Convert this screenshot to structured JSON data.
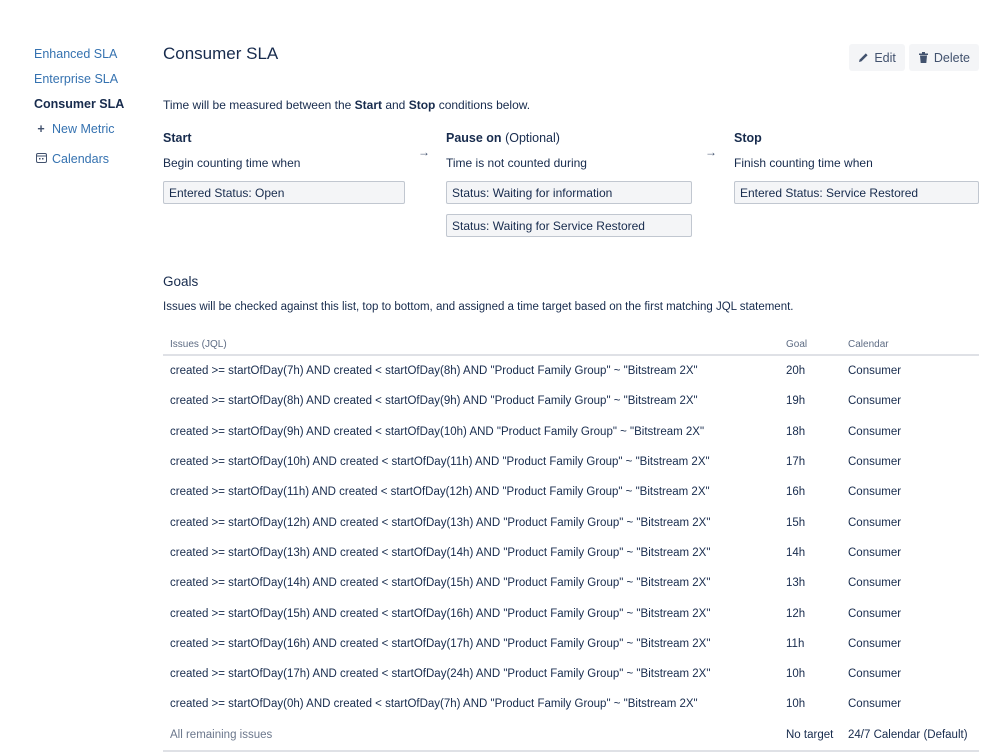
{
  "sidebar": {
    "items": [
      {
        "label": "Enhanced SLA"
      },
      {
        "label": "Enterprise SLA"
      },
      {
        "label": "Consumer SLA"
      },
      {
        "label": "New Metric",
        "icon": "plus-icon"
      },
      {
        "label": "Calendars",
        "icon": "calendar-icon"
      }
    ]
  },
  "header": {
    "title": "Consumer SLA",
    "edit_label": "Edit",
    "delete_label": "Delete"
  },
  "intro": {
    "prefix": "Time will be measured between the ",
    "start_word": "Start",
    "middle": " and ",
    "stop_word": "Stop",
    "suffix": " conditions below."
  },
  "conditions": {
    "start": {
      "heading": "Start",
      "description": "Begin counting time when",
      "items": [
        "Entered Status: Open"
      ]
    },
    "pause": {
      "heading": "Pause on",
      "optional": "(Optional)",
      "description": "Time is not counted during",
      "items": [
        "Status: Waiting for information",
        "Status: Waiting for Service Restored"
      ]
    },
    "stop": {
      "heading": "Stop",
      "description": "Finish counting time when",
      "items": [
        "Entered Status: Service Restored"
      ]
    },
    "arrow": "→"
  },
  "goals": {
    "title": "Goals",
    "description": "Issues will be checked against this list, top to bottom, and assigned a time target based on the first matching JQL statement.",
    "columns": {
      "jql": "Issues (JQL)",
      "goal": "Goal",
      "calendar": "Calendar"
    },
    "rows": [
      {
        "jql": "created >= startOfDay(7h) AND created < startOfDay(8h) AND \"Product Family Group\" ~ \"Bitstream 2X\"",
        "goal": "20h",
        "calendar": "Consumer"
      },
      {
        "jql": "created >= startOfDay(8h) AND created < startOfDay(9h) AND \"Product Family Group\" ~ \"Bitstream 2X\"",
        "goal": "19h",
        "calendar": "Consumer"
      },
      {
        "jql": "created >= startOfDay(9h) AND created < startOfDay(10h) AND \"Product Family Group\" ~ \"Bitstream 2X\"",
        "goal": "18h",
        "calendar": "Consumer"
      },
      {
        "jql": "created >= startOfDay(10h) AND created < startOfDay(11h) AND \"Product Family Group\" ~ \"Bitstream 2X\"",
        "goal": "17h",
        "calendar": "Consumer"
      },
      {
        "jql": "created >= startOfDay(11h) AND created < startOfDay(12h) AND \"Product Family Group\" ~ \"Bitstream 2X\"",
        "goal": "16h",
        "calendar": "Consumer"
      },
      {
        "jql": "created >= startOfDay(12h) AND created < startOfDay(13h) AND \"Product Family Group\" ~ \"Bitstream 2X\"",
        "goal": "15h",
        "calendar": "Consumer"
      },
      {
        "jql": "created >= startOfDay(13h) AND created < startOfDay(14h) AND \"Product Family Group\" ~ \"Bitstream 2X\"",
        "goal": "14h",
        "calendar": "Consumer"
      },
      {
        "jql": "created >= startOfDay(14h) AND created < startOfDay(15h) AND \"Product Family Group\" ~ \"Bitstream 2X\"",
        "goal": "13h",
        "calendar": "Consumer"
      },
      {
        "jql": "created >= startOfDay(15h) AND created < startOfDay(16h) AND \"Product Family Group\" ~ \"Bitstream 2X\"",
        "goal": "12h",
        "calendar": "Consumer"
      },
      {
        "jql": "created >= startOfDay(16h) AND created < startOfDay(17h) AND \"Product Family Group\" ~ \"Bitstream 2X\"",
        "goal": "11h",
        "calendar": "Consumer"
      },
      {
        "jql": "created >= startOfDay(17h) AND created < startOfDay(24h) AND \"Product Family Group\" ~ \"Bitstream 2X\"",
        "goal": "10h",
        "calendar": "Consumer"
      },
      {
        "jql": "created >= startOfDay(0h) AND created < startOfDay(7h) AND \"Product Family Group\" ~ \"Bitstream 2X\"",
        "goal": "10h",
        "calendar": "Consumer"
      }
    ],
    "remaining": {
      "jql": "All remaining issues",
      "goal": "No target",
      "calendar": "24/7 Calendar (Default)"
    }
  }
}
